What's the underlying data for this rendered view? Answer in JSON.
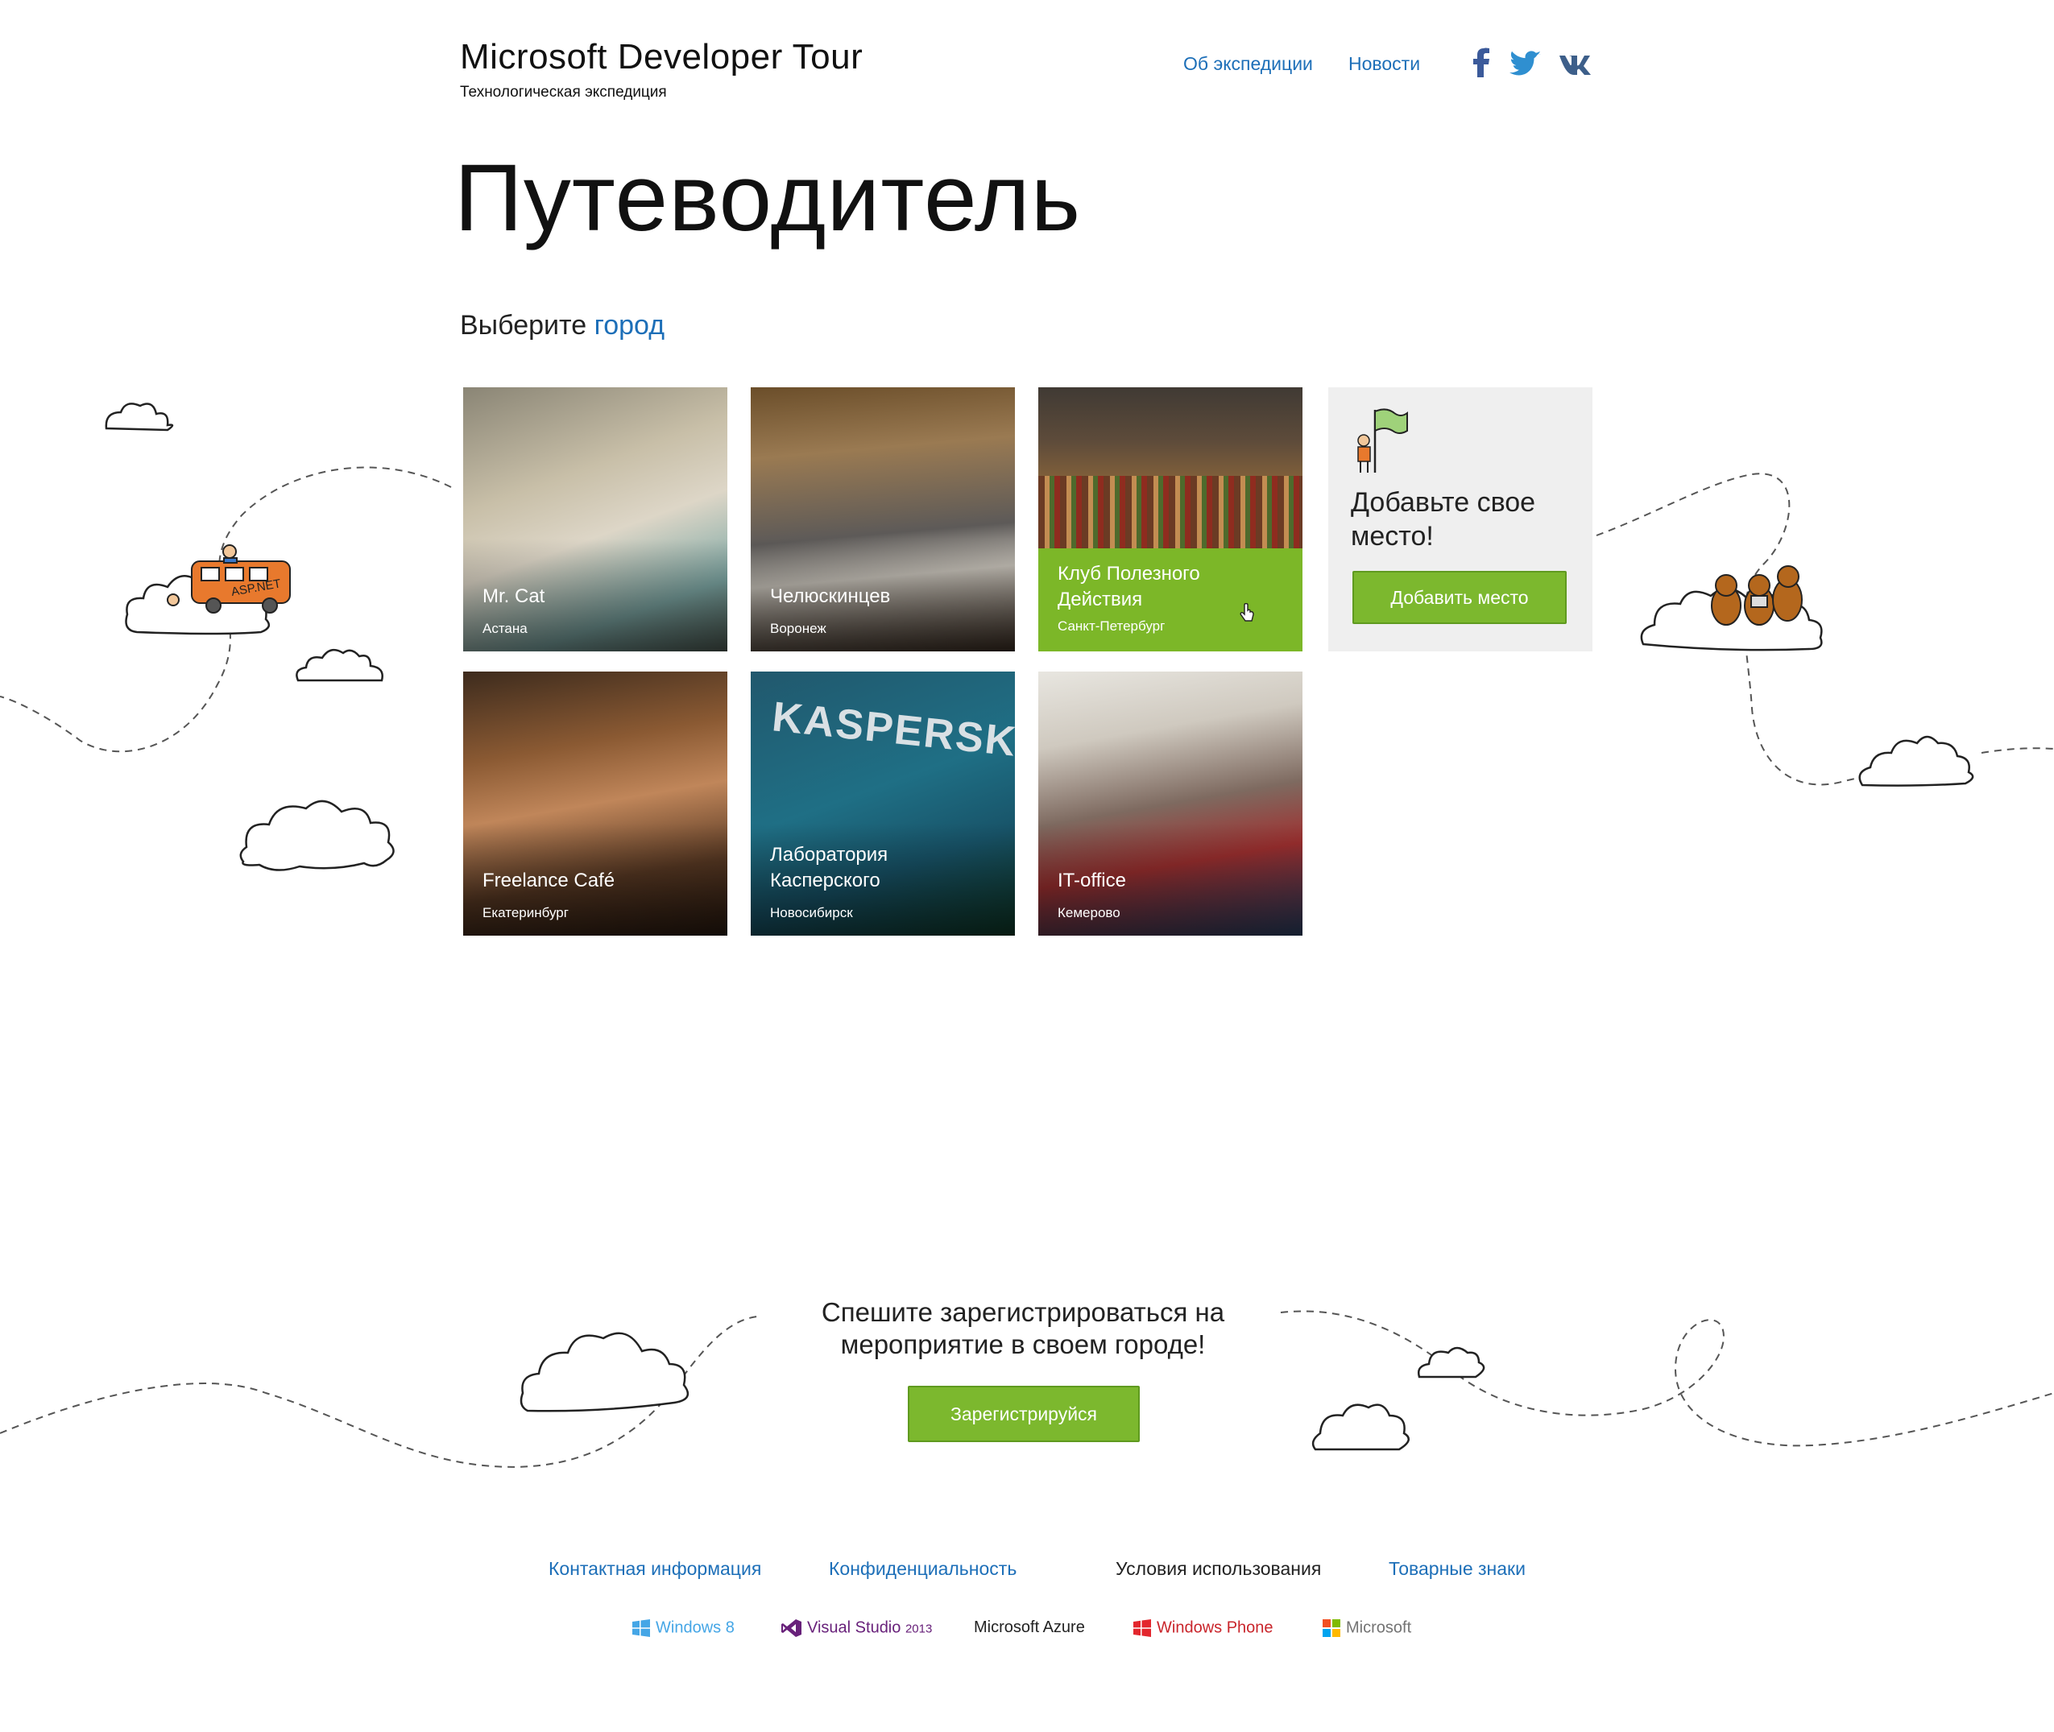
{
  "header": {
    "title": "Microsoft Developer Tour",
    "subtitle": "Технологическая экспедиция",
    "nav": {
      "about": "Об экспедиции",
      "news": "Новости"
    },
    "social": [
      "facebook-icon",
      "twitter-icon",
      "vk-icon"
    ]
  },
  "page_title": "Путеводитель",
  "choose": {
    "prefix": "Выберите ",
    "city_link": "город"
  },
  "tiles": [
    {
      "name": "Mr. Cat",
      "city": "Астана"
    },
    {
      "name": "Челюскинцев",
      "city": "Воронеж"
    },
    {
      "name": "Клуб Полезного Действия",
      "city": "Санкт-Петербург"
    },
    {
      "name": "Freelance Café",
      "city": "Екатеринбург"
    },
    {
      "name": "Лаборатория Касперского",
      "city": "Новосибирск"
    },
    {
      "name": "IT-office",
      "city": "Кемерово"
    }
  ],
  "add_place": {
    "title": "Добавьте свое место!",
    "button": "Добавить место"
  },
  "register": {
    "text": "Спешите зарегистрироваться на мероприятие в своем городе!",
    "button": "Зарегистрируйся"
  },
  "footer": {
    "links": {
      "contact": "Контактная информация",
      "privacy": "Конфиденциальность",
      "terms": "Условия использования",
      "trademarks": "Товарные знаки"
    },
    "brands": {
      "windows8": "Windows 8",
      "visualstudio": "Visual Studio",
      "visualstudio_year": "2013",
      "azure": "Microsoft Azure",
      "windowsphone": "Windows Phone",
      "microsoft": "Microsoft"
    }
  },
  "colors": {
    "accent": "#1d6fb8",
    "green": "#7cb82e",
    "tile_green": "#7cb728"
  }
}
